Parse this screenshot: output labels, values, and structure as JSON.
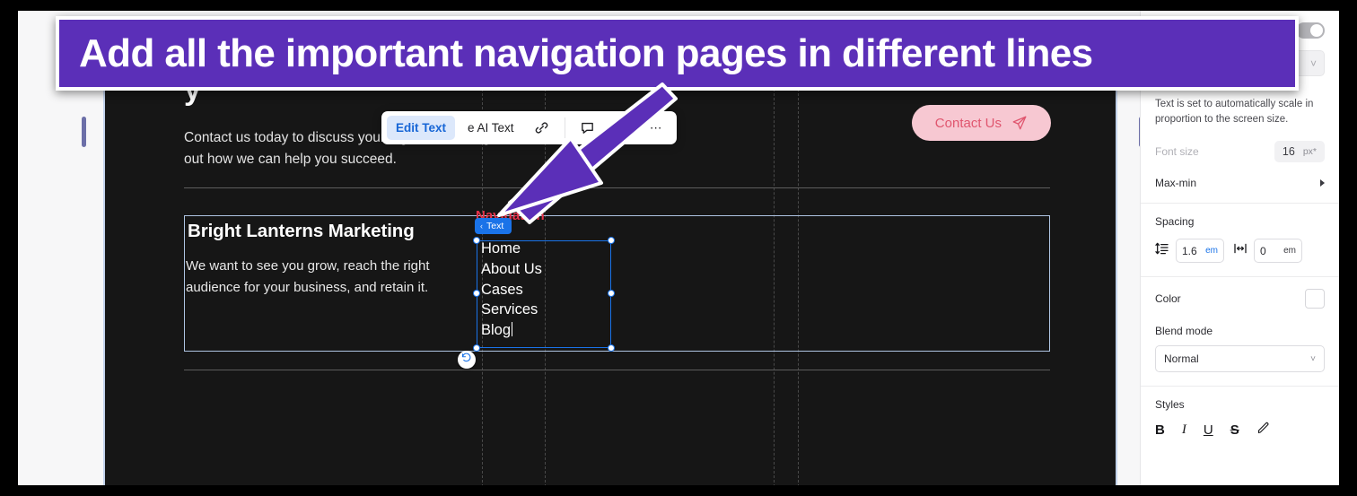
{
  "callout": {
    "text": "Add all the important navigation pages in different lines",
    "bg_color": "#5b2fb8",
    "text_color": "#ffffff",
    "arrow_color": "#5b2fb8"
  },
  "canvas": {
    "background_color": "#161616",
    "hero": {
      "heading_partial": "y",
      "subtext": "Contact us today to discuss your digital marketing needs and find out how we can help you succeed.",
      "contact_button": {
        "label": "Contact Us",
        "icon": "paper-plane-icon",
        "bg_color": "#f7c8d2",
        "text_color": "#e0566f"
      }
    },
    "section": {
      "brand_title": "Bright Lanterns Marketing",
      "brand_body": "We want to see you grow, reach the right audience for your business, and retain it.",
      "nav_label": "Navigation",
      "nav_items": [
        "Home",
        "About Us",
        "Cases",
        "Services",
        "Blog"
      ],
      "selection_badge": "Text",
      "selection_badge_chevron": "‹",
      "reset_icon": "undo-icon"
    }
  },
  "context_toolbar": {
    "items": [
      {
        "label": "Edit Text",
        "name": "edit-text-button",
        "active": true
      },
      {
        "label": "e AI Text",
        "name": "ai-text-button",
        "active": false
      }
    ],
    "icons": [
      {
        "name": "link-icon"
      },
      {
        "name": "comment-icon"
      },
      {
        "name": "help-icon",
        "glyph": "?"
      },
      {
        "name": "more-options-icon",
        "glyph": "⋯"
      }
    ]
  },
  "right_panel": {
    "toggle": {
      "name": "auto-scale-toggle",
      "state": "on",
      "color": "#b4b4b8"
    },
    "collapsed_select_chevron": "˅",
    "note": "Text is set to automatically scale in proportion to the screen size.",
    "font_size": {
      "label": "Font size",
      "value": "16",
      "unit": "px*"
    },
    "max_min": {
      "label": "Max-min",
      "chevron": "caret-right-icon"
    },
    "spacing": {
      "label": "Spacing",
      "line_height": {
        "icon": "line-height-icon",
        "value": "1.6",
        "unit": "em"
      },
      "letter_spacing": {
        "icon": "letter-spacing-icon",
        "value": "0",
        "unit": "em"
      }
    },
    "color": {
      "label": "Color",
      "swatch": "#ffffff"
    },
    "blend_mode": {
      "label": "Blend mode",
      "value": "Normal",
      "chevron": "˅"
    },
    "styles": {
      "label": "Styles",
      "buttons": [
        {
          "name": "bold-button",
          "glyph": "B"
        },
        {
          "name": "italic-button",
          "glyph": "I"
        },
        {
          "name": "underline-button",
          "glyph": "U"
        },
        {
          "name": "strikethrough-button",
          "glyph": "S"
        },
        {
          "name": "highlight-pen-icon",
          "glyph": ""
        }
      ]
    }
  }
}
